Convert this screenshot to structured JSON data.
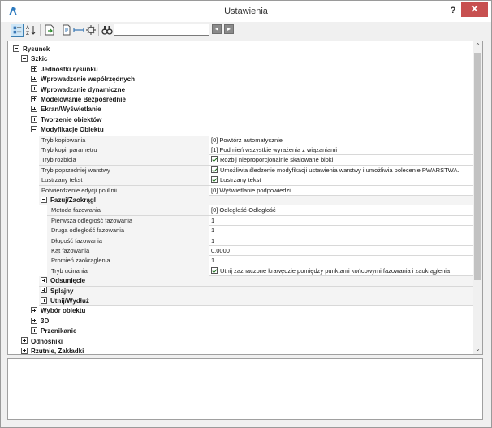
{
  "window": {
    "title": "Ustawienia",
    "help_label": "?",
    "close_label": "✕",
    "accent_close": "#c75050"
  },
  "toolbar": {
    "search_value": "",
    "prev_label": "◂",
    "next_label": "▸"
  },
  "tree": {
    "root": "Rysunek",
    "szkic": "Szkic",
    "jednostki": "Jednostki rysunku",
    "wprowadzenie_wsp": "Wprowadzenie współrzędnych",
    "wprowadzenie_dyn": "Wprowadzanie dynamiczne",
    "modelowanie": "Modelowanie Bezpośrednie",
    "ekran": "Ekran/Wyświetlanie",
    "tworzenie": "Tworzenie obiektów",
    "modyfikacje": "Modyfikacje Obiektu",
    "fazuj": "Fazuj/Zaokrągl",
    "odsuniecie": "Odsunięcie",
    "splajny": "Splajny",
    "utnij": "Utnij/Wydłuż",
    "wybor": "Wybór obiektu",
    "d3": "3D",
    "przenikanie": "Przenikanie",
    "odnosniki": "Odnośniki",
    "rzutnie": "Rzutnie, Zakładki"
  },
  "props": [
    {
      "name": "Tryb kopiowania",
      "value": "[0] Powtórz automatycznie",
      "check": false
    },
    {
      "name": "Tryb kopii parametru",
      "value": "[1] Podmień wszystkie wyrażenia z wiązaniami",
      "check": false
    },
    {
      "name": "Tryb rozbicia",
      "value": "Rozbij nieproporcjonalnie skalowane bloki",
      "check": true
    },
    {
      "name": "Tryb poprzedniej warstwy",
      "value": "Umożliwia śledzenie modyfikacji ustawienia warstwy i umożliwia polecenie PWARSTWA.",
      "check": true
    },
    {
      "name": "Lustrzany tekst",
      "value": "Lustrzany tekst",
      "check": true
    },
    {
      "name": "Potwierdzenie edycji polilinii",
      "value": "[0] Wyświetlanie podpowiedzi",
      "check": false
    }
  ],
  "fazuj_props": [
    {
      "name": "Metoda fazowania",
      "value": "[0] Odległość-Odległość",
      "check": false
    },
    {
      "name": "Pierwsza odległość fazowania",
      "value": "1",
      "check": false
    },
    {
      "name": "Druga odległość fazowania",
      "value": "1",
      "check": false
    },
    {
      "name": "Długość fazowania",
      "value": "1",
      "check": false
    },
    {
      "name": "Kąt fazowania",
      "value": "0.0000",
      "check": false
    },
    {
      "name": "Promień zaokrąglenia",
      "value": "1",
      "check": false
    },
    {
      "name": "Tryb ucinania",
      "value": "Utnij zaznaczone krawędzie pomiędzy punktami końcowymi fazowania i zaokrąglenia",
      "check": true
    }
  ],
  "scroll": {
    "up": "⌃",
    "down": "⌄"
  }
}
